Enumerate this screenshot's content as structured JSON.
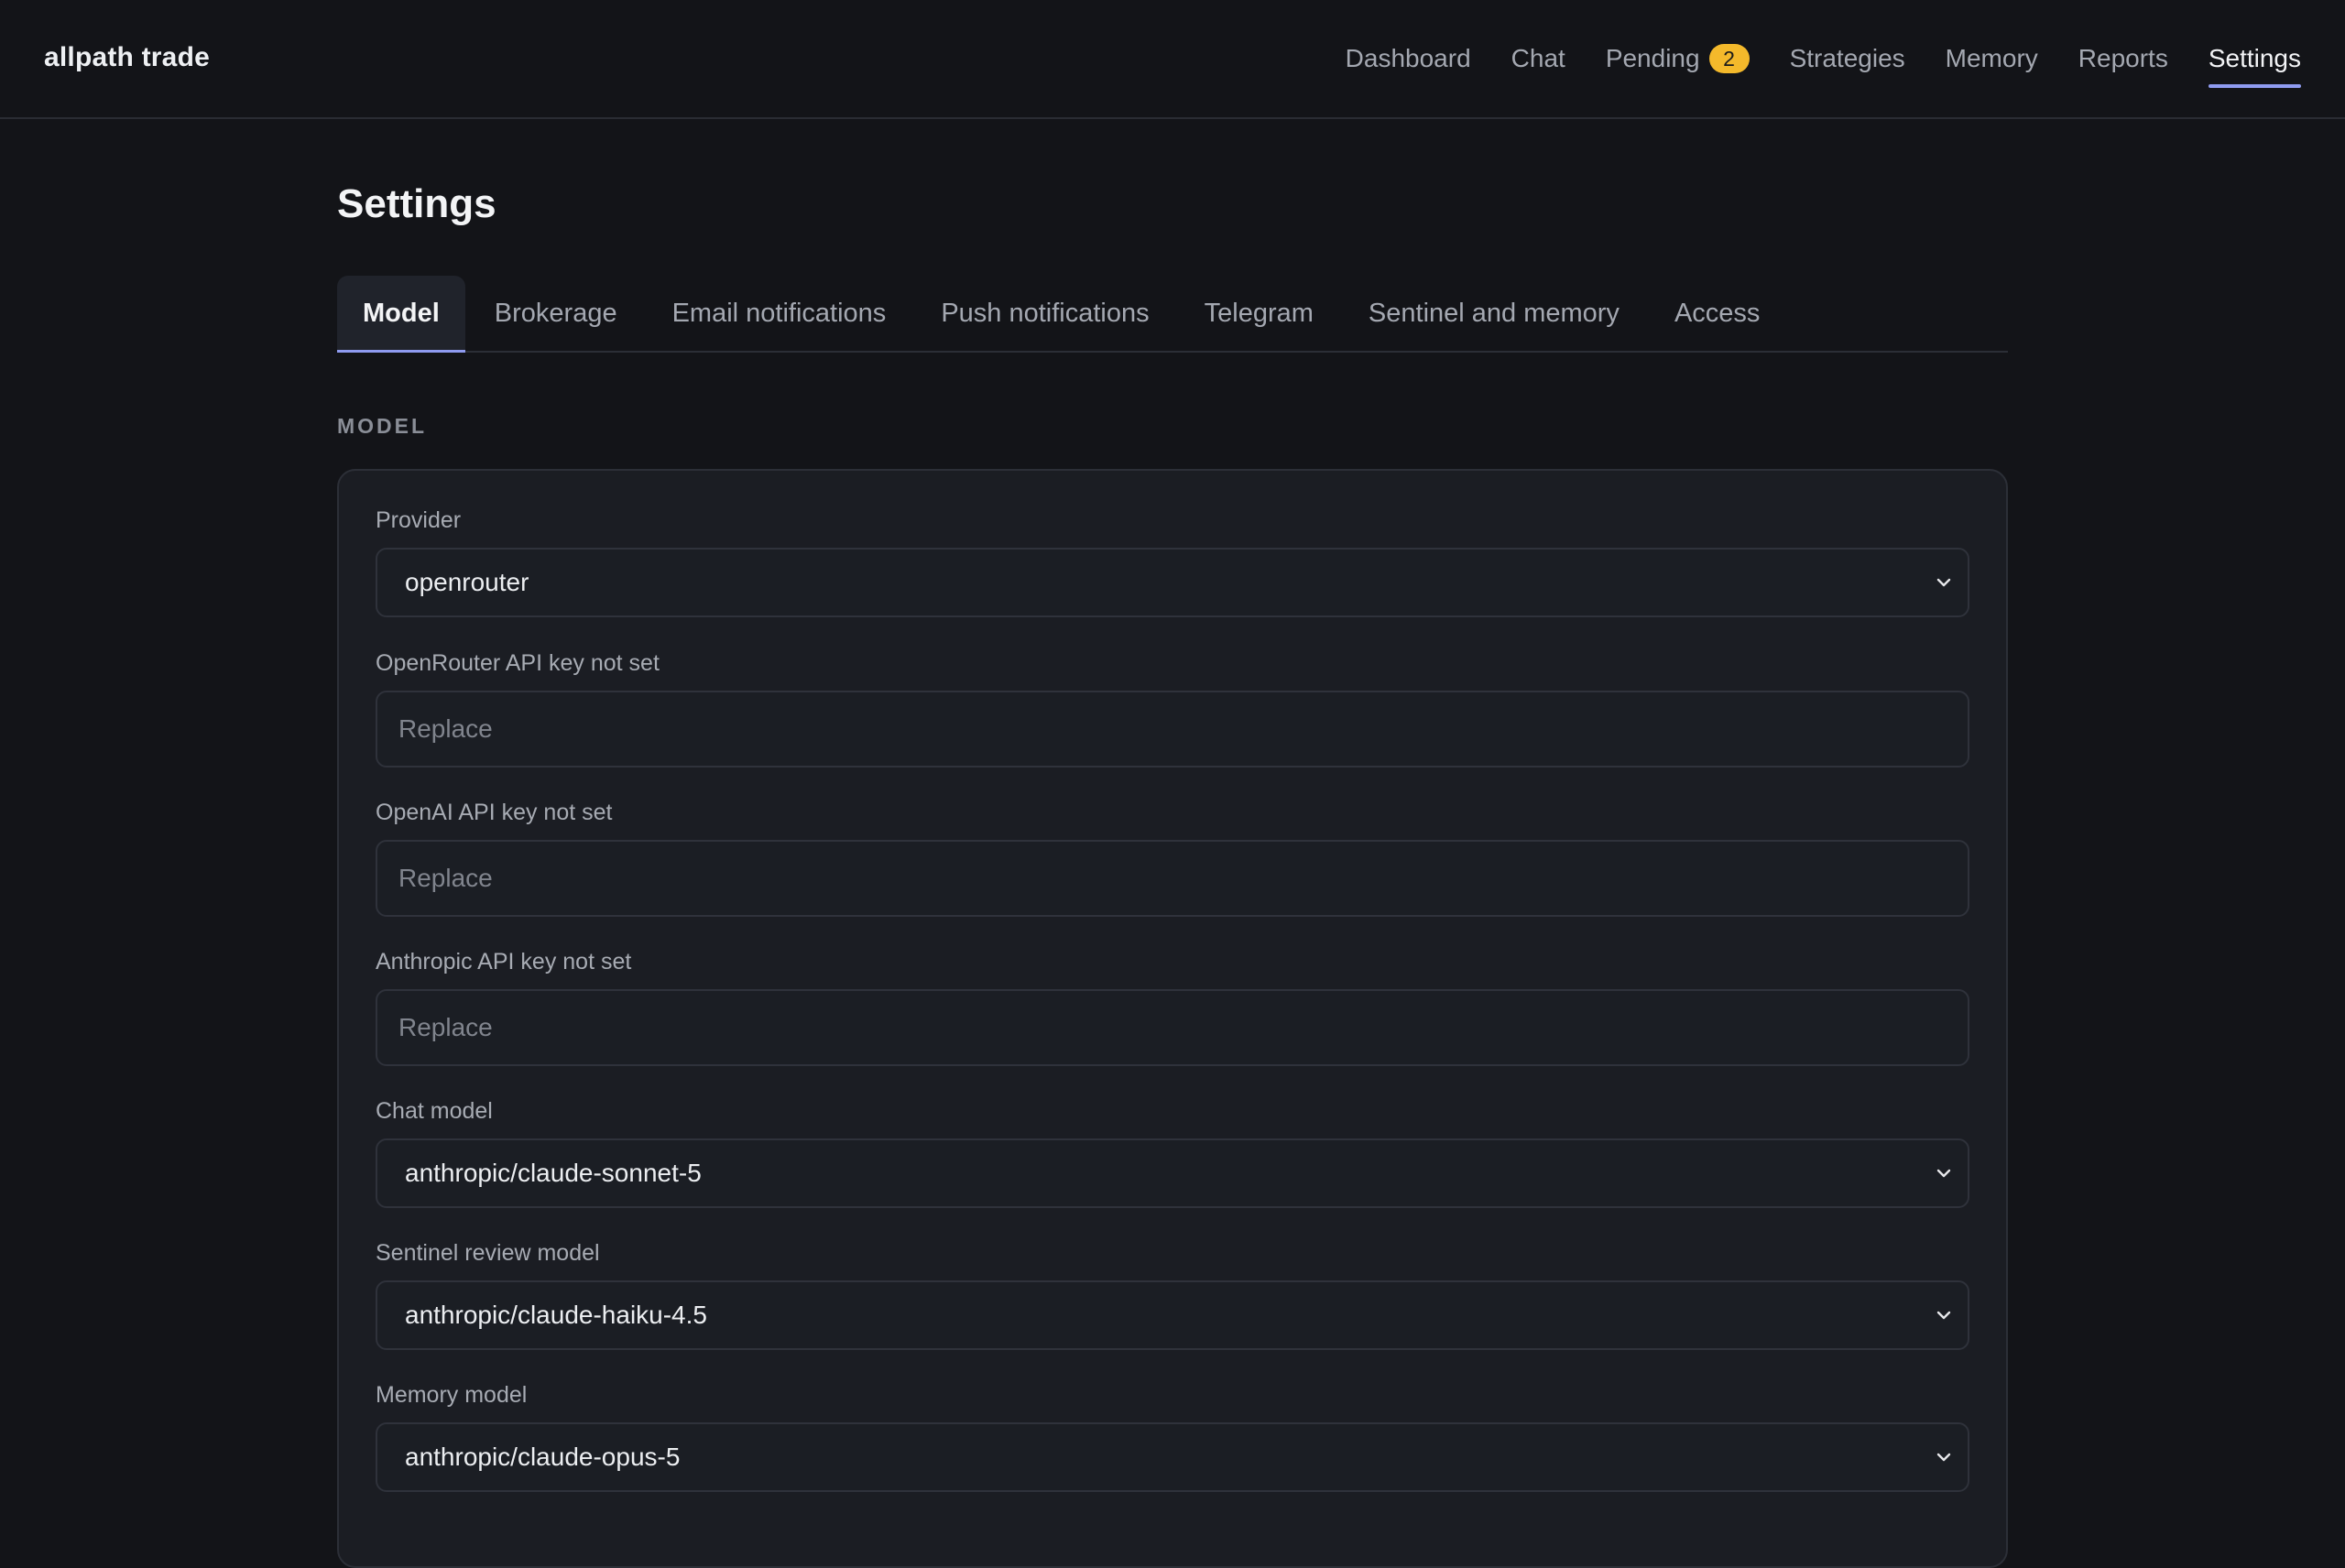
{
  "app": {
    "brand": "allpath trade"
  },
  "nav": {
    "items": [
      {
        "label": "Dashboard"
      },
      {
        "label": "Chat"
      },
      {
        "label": "Pending",
        "badge": "2"
      },
      {
        "label": "Strategies"
      },
      {
        "label": "Memory"
      },
      {
        "label": "Reports"
      },
      {
        "label": "Settings",
        "active": true
      }
    ]
  },
  "page": {
    "title": "Settings"
  },
  "tabs": [
    {
      "label": "Model",
      "active": true
    },
    {
      "label": "Brokerage"
    },
    {
      "label": "Email notifications"
    },
    {
      "label": "Push notifications"
    },
    {
      "label": "Telegram"
    },
    {
      "label": "Sentinel and memory"
    },
    {
      "label": "Access"
    }
  ],
  "section": {
    "title": "MODEL"
  },
  "form": {
    "provider": {
      "label": "Provider",
      "value": "openrouter"
    },
    "openrouter_key": {
      "label": "OpenRouter API key not set",
      "placeholder": "Replace"
    },
    "openai_key": {
      "label": "OpenAI API key not set",
      "placeholder": "Replace"
    },
    "anthropic_key": {
      "label": "Anthropic API key not set",
      "placeholder": "Replace"
    },
    "chat_model": {
      "label": "Chat model",
      "value": "anthropic/claude-sonnet-5"
    },
    "sentinel_model": {
      "label": "Sentinel review model",
      "value": "anthropic/claude-haiku-4.5"
    },
    "memory_model": {
      "label": "Memory model",
      "value": "anthropic/claude-opus-5"
    }
  },
  "colors": {
    "background": "#131418",
    "card": "#1b1d23",
    "accent": "#8f9bf0",
    "badge": "#f4b92b"
  },
  "icons": {
    "select_caret": "chevron-down-icon"
  }
}
